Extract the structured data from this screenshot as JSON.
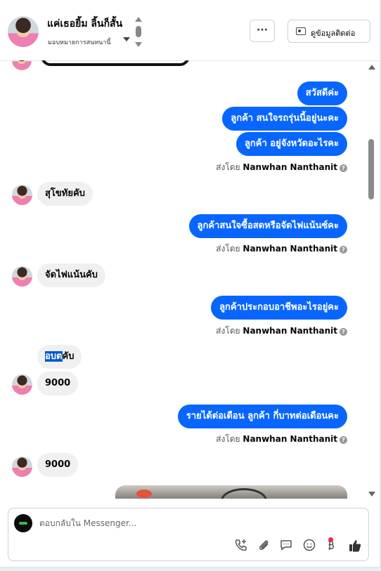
{
  "header": {
    "name": "แค่เธอยิ้ม ลิ้นก็สั้น",
    "subtitle": "มอบหมายการสนทนานี้",
    "more_label": "···",
    "contact_label": "ดูข้อมูลติดต่อ"
  },
  "messages": {
    "out1": "สวัสดีค่ะ",
    "out2": "ลูกค้า สนใจรถรุ่นนี้อยู่นะคะ",
    "out3": "ลูกค้า อยู่จังหวัดอะไรคะ",
    "sent_prefix": "ส่งโดย",
    "sent_name": "Nanwhan Nanthanit",
    "sent_q": "?",
    "in1": "สุโขทัยคับ",
    "out4": "ลูกค้าสนใจซื้อสดหรือจัดไฟแน้นซ์คะ",
    "in2": "จัดไฟแน้นคับ",
    "out5": "ลูกค้าประกอบอาชีพอะไรอยู่คะ",
    "in3_highlight": "อบต",
    "in3_rest": "คับ",
    "in4": "9000",
    "out6": "รายได้ต่อเดือน  ลูกค้า กี่บาทต่อเดือนคะ",
    "in5": "9000"
  },
  "composer": {
    "placeholder": "ตอบกลับใน Messenger...",
    "icons": [
      "add-call-icon",
      "attach-icon",
      "saved-reply-icon",
      "emoji-icon",
      "payment-icon",
      "thumbs-up-icon"
    ],
    "accent": "#0866ff"
  }
}
